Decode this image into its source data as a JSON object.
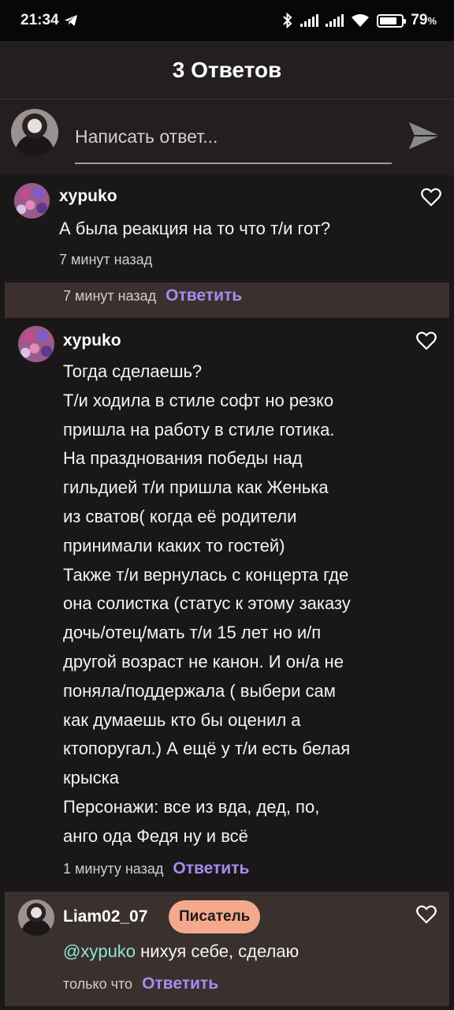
{
  "status_bar": {
    "time": "21:34",
    "battery": "79",
    "battery_unit": "%",
    "battery_level": 0.79
  },
  "header": {
    "title": "3 Ответов"
  },
  "composer": {
    "placeholder": "Написать ответ..."
  },
  "comments": [
    {
      "author": "xypuko",
      "text": "А была реакция на то что т/и гот?",
      "time": "7 минут назад",
      "reply_strip_time": "7 минут назад",
      "reply_label": "Ответить"
    },
    {
      "author": "xypuko",
      "text": "Тогда сделаешь?\nТ/и ходила в стиле софт  но резко\nпришла на работу в стиле готика.\nНа празднования победы над\nгильдией т/и пришла как Женька\nиз сватов( когда её родители\nпринимали каких то гостей)\nТакже т/и вернулась с концерта где\nона солистка (статус к этому заказу\nдочь/отец/мать т/и 15 лет но и/п\nдругой возраст не канон. И он/а не\nпоняла/поддержала ( выбери сам\nкак думаешь кто бы оценил а\nктопоругал.) А ещё у т/и есть белая\nкрыска\nПерсонажи: все из вда, дед, по,\nанго  ода Федя ну и всё",
      "time": "1 минуту назад",
      "reply_label": "Ответить"
    },
    {
      "author": "Liam02_07",
      "badge": "Писатель",
      "mention": "@xypuko",
      "text": " нихуя себе, сделаю",
      "time": "только что",
      "reply_label": "Ответить"
    }
  ],
  "colors": {
    "accent": "#a48cf0",
    "badge": "#f4a98c",
    "mention": "#8fe4da",
    "background": "#1a1718"
  },
  "icons": [
    "telegram-icon",
    "bluetooth-icon",
    "signal-icon",
    "wifi-icon",
    "battery-icon",
    "avatar",
    "send-icon",
    "heart-icon"
  ]
}
